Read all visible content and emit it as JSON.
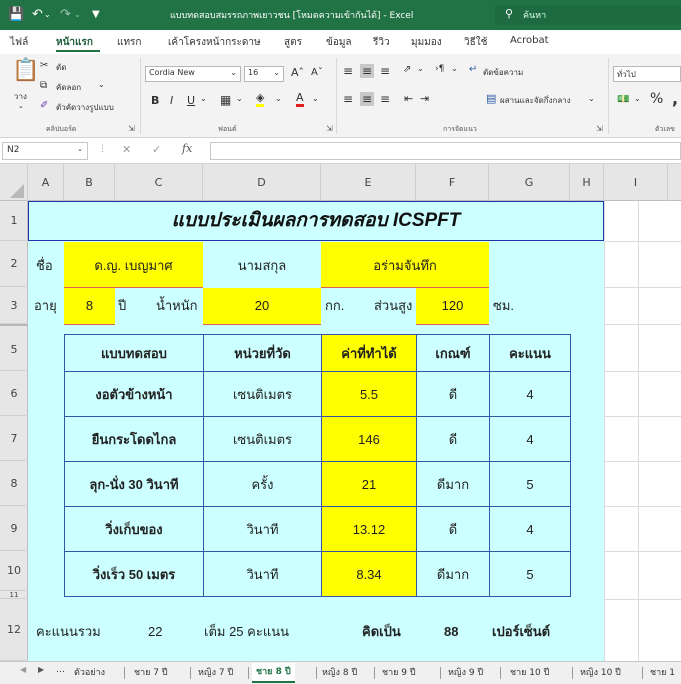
{
  "titlebar": {
    "doc_title": "แบบทดสอบสมรรถภาพเยาวชน [โหมดความเข้ากันได้] - Excel",
    "search_placeholder": "ค้นหา"
  },
  "ribbon_tabs": [
    "ไฟล์",
    "หน้าแรก",
    "แทรก",
    "เค้าโครงหน้ากระดาษ",
    "สูตร",
    "ข้อมูล",
    "รีวิว",
    "มุมมอง",
    "วิธีใช้",
    "Acrobat"
  ],
  "ribbon": {
    "paste": "วาง",
    "cut": "ตัด",
    "copy": "คัดลอก",
    "format_painter": "ตัวคัดวางรูปแบบ",
    "clipboard_group": "คลิปบอร์ด",
    "font_name": "Cordia New",
    "font_size": "16",
    "font_group": "ฟอนต์",
    "wrap_text": "ตัดข้อความ",
    "merge_center": "ผสานและจัดกึ่งกลาง",
    "align_group": "การจัดแนว",
    "number_format": "ทั่วไป",
    "number_group": "ตัวเลข"
  },
  "name_box": "N2",
  "fx": "fx",
  "columns": [
    "A",
    "B",
    "C",
    "D",
    "E",
    "F",
    "G",
    "H",
    "I"
  ],
  "rows": [
    "1",
    "2",
    "3",
    "5",
    "6",
    "7",
    "8",
    "9",
    "10",
    "11",
    "12"
  ],
  "sheet": {
    "title": "แบบประเมินผลการทดสอบ ICSPFT",
    "name_label": "ชื่อ",
    "first_name": "ด.ญ. เบญมาศ",
    "surname_label": "นามสกุล",
    "surname": "อร่ามจันทึก",
    "age_label": "อายุ",
    "age": "8",
    "year_label": "ปี",
    "weight_label": "น้ำหนัก",
    "weight": "20",
    "kg": "กก.",
    "height_label": "ส่วนสูง",
    "height": "120",
    "cm": "ซม.",
    "headers": [
      "แบบทดสอบ",
      "หน่วยที่วัด",
      "ค่าที่ทำได้",
      "เกณฑ์",
      "คะแนน"
    ],
    "tests": [
      {
        "name": "งอตัวข้างหน้า",
        "unit": "เซนติเมตร",
        "value": "5.5",
        "grade": "ดี",
        "score": "4"
      },
      {
        "name": "ยืนกระโดดไกล",
        "unit": "เซนติเมตร",
        "value": "146",
        "grade": "ดี",
        "score": "4"
      },
      {
        "name": "ลุก-นั่ง 30 วินาที",
        "unit": "ครั้ง",
        "value": "21",
        "grade": "ดีมาก",
        "score": "5"
      },
      {
        "name": "วิ่งเก็บของ",
        "unit": "วินาที",
        "value": "13.12",
        "grade": "ดี",
        "score": "4"
      },
      {
        "name": "วิ่งเร็ว 50 เมตร",
        "unit": "วินาที",
        "value": "8.34",
        "grade": "ดีมาก",
        "score": "5"
      }
    ],
    "total_label": "คะแนนรวม",
    "total": "22",
    "full_label": "เต็ม 25 คะแนน",
    "calc_label": "คิดเป็น",
    "percent": "88",
    "percent_label": "เปอร์เซ็นต์"
  },
  "sheet_tabs": [
    "ตัวอย่าง",
    "ชาย 7 ปี",
    "หญิง 7 ปี",
    "ชาย 8 ปี",
    "หญิง 8 ปี",
    "ชาย 9 ปี",
    "หญิง 9 ปี",
    "ชาย 10 ปี",
    "หญิง 10 ปี",
    "ชาย 1"
  ],
  "active_sheet": "ชาย 8 ปี"
}
